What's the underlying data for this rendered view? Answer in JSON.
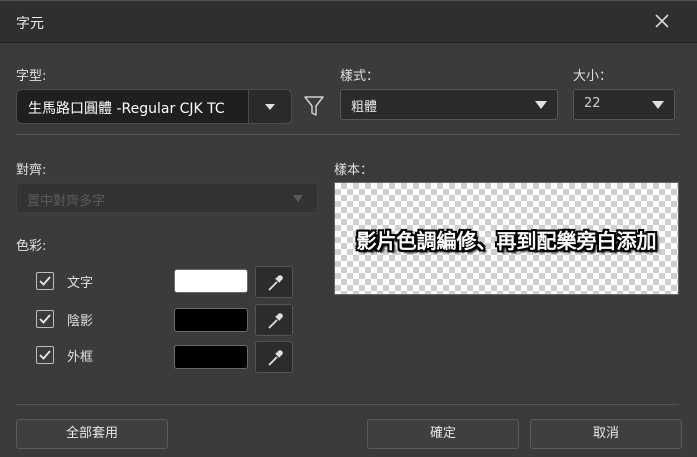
{
  "window": {
    "title": "字元"
  },
  "font": {
    "label": "字型:",
    "value": "生馬路口圓體 -Regular CJK TC"
  },
  "style": {
    "label": "樣式：",
    "value": "粗體"
  },
  "size": {
    "label": "大小：",
    "value": "22"
  },
  "alignment": {
    "label": "對齊:",
    "value": "置中對齊多字"
  },
  "color": {
    "label": "色彩:",
    "rows": [
      {
        "label": "文字",
        "checked": true,
        "swatch": "#ffffff"
      },
      {
        "label": "陰影",
        "checked": true,
        "swatch": "#000000"
      },
      {
        "label": "外框",
        "checked": true,
        "swatch": "#000000"
      }
    ]
  },
  "preview": {
    "label": "樣本：",
    "sample_text": "影片色調編修、再到配樂旁白添加"
  },
  "buttons": {
    "apply_all": "全部套用",
    "ok": "確定",
    "cancel": "取消"
  },
  "icons": {
    "close": "close-icon",
    "filter": "filter-icon",
    "eyedropper": "eyedropper-icon",
    "check": "check-icon",
    "dropdown": "chevron-down-icon"
  },
  "colors": {
    "background": "#3b3b3b",
    "titlebar": "#2f2f2f",
    "input_bg": "#2b2b2b"
  }
}
